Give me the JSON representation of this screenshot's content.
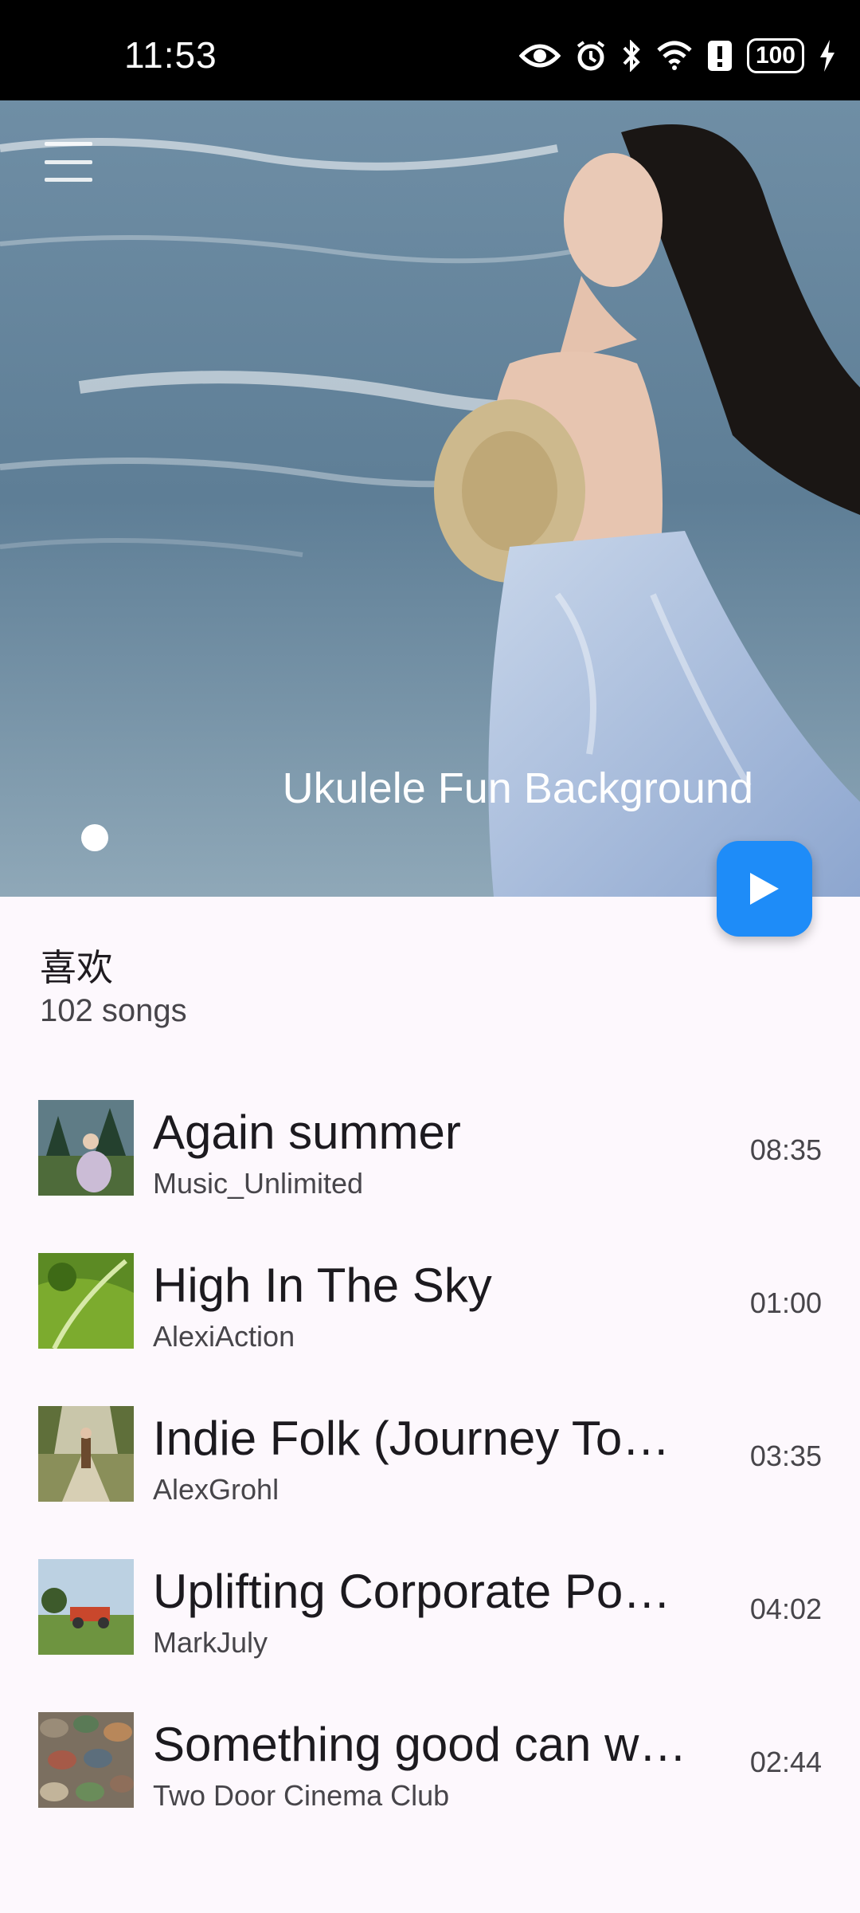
{
  "status_bar": {
    "time": "11:53",
    "battery": "100",
    "icons": [
      "eye-icon",
      "alarm-icon",
      "bluetooth-icon",
      "wifi-icon",
      "alert-icon",
      "battery-icon",
      "charging-icon"
    ]
  },
  "hero": {
    "title": "Ukulele Fun Background",
    "menu_icon": "hamburger-menu-icon",
    "play_icon": "play-icon"
  },
  "playlist": {
    "name": "喜欢",
    "count": "102 songs"
  },
  "songs": [
    {
      "title": "Again summer",
      "artist": "Music_Unlimited",
      "duration": "08:35"
    },
    {
      "title": "High In The Sky",
      "artist": "AlexiAction",
      "duration": "01:00"
    },
    {
      "title": "Indie Folk (Journey To…",
      "artist": "AlexGrohl",
      "duration": "03:35"
    },
    {
      "title": "Uplifting Corporate Po…",
      "artist": "MarkJuly",
      "duration": "04:02"
    },
    {
      "title": "Something good can w…",
      "artist": "Two Door Cinema Club",
      "duration": "02:44"
    }
  ],
  "colors": {
    "accent": "#1e8cf8",
    "background": "#fdf8fd"
  }
}
